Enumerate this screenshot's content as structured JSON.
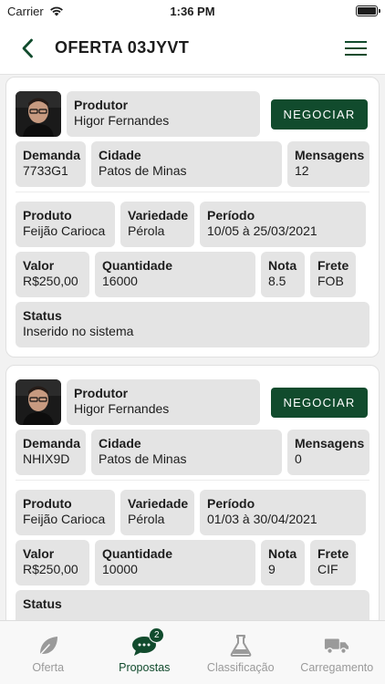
{
  "status_bar": {
    "carrier": "Carrier",
    "time": "1:36 PM"
  },
  "header": {
    "title": "OFERTA 03JYVT"
  },
  "offers": [
    {
      "produtor_label": "Produtor",
      "produtor": "Higor Fernandes",
      "negociar_label": "NEGOCIAR",
      "demanda_label": "Demanda",
      "demanda": "7733G1",
      "cidade_label": "Cidade",
      "cidade": "Patos de Minas",
      "mensagens_label": "Mensagens",
      "mensagens": "12",
      "produto_label": "Produto",
      "produto": "Feijão Carioca",
      "variedade_label": "Variedade",
      "variedade": "Pérola",
      "periodo_label": "Período",
      "periodo": "10/05 à 25/03/2021",
      "valor_label": "Valor",
      "valor": "R$250,00",
      "quantidade_label": "Quantidade",
      "quantidade": "16000",
      "nota_label": "Nota",
      "nota": "8.5",
      "frete_label": "Frete",
      "frete": "FOB",
      "status_label": "Status",
      "status": "Inserido no sistema"
    },
    {
      "produtor_label": "Produtor",
      "produtor": "Higor Fernandes",
      "negociar_label": "NEGOCIAR",
      "demanda_label": "Demanda",
      "demanda": "NHIX9D",
      "cidade_label": "Cidade",
      "cidade": "Patos de Minas",
      "mensagens_label": "Mensagens",
      "mensagens": "0",
      "produto_label": "Produto",
      "produto": "Feijão Carioca",
      "variedade_label": "Variedade",
      "variedade": "Pérola",
      "periodo_label": "Período",
      "periodo": "01/03 à 30/04/2021",
      "valor_label": "Valor",
      "valor": "R$250,00",
      "quantidade_label": "Quantidade",
      "quantidade": "10000",
      "nota_label": "Nota",
      "nota": "9",
      "frete_label": "Frete",
      "frete": "CIF",
      "status_label": "Status",
      "status": ""
    }
  ],
  "tabs": [
    {
      "label": "Oferta",
      "icon": "leaf-icon"
    },
    {
      "label": "Propostas",
      "icon": "chat-bubble-icon",
      "badge": "2"
    },
    {
      "label": "Classificação",
      "icon": "flask-icon"
    },
    {
      "label": "Carregamento",
      "icon": "truck-icon"
    }
  ],
  "colors": {
    "accent": "#114b2d",
    "field_bg": "#e4e4e4",
    "inactive_tab": "#9a9a9a"
  }
}
